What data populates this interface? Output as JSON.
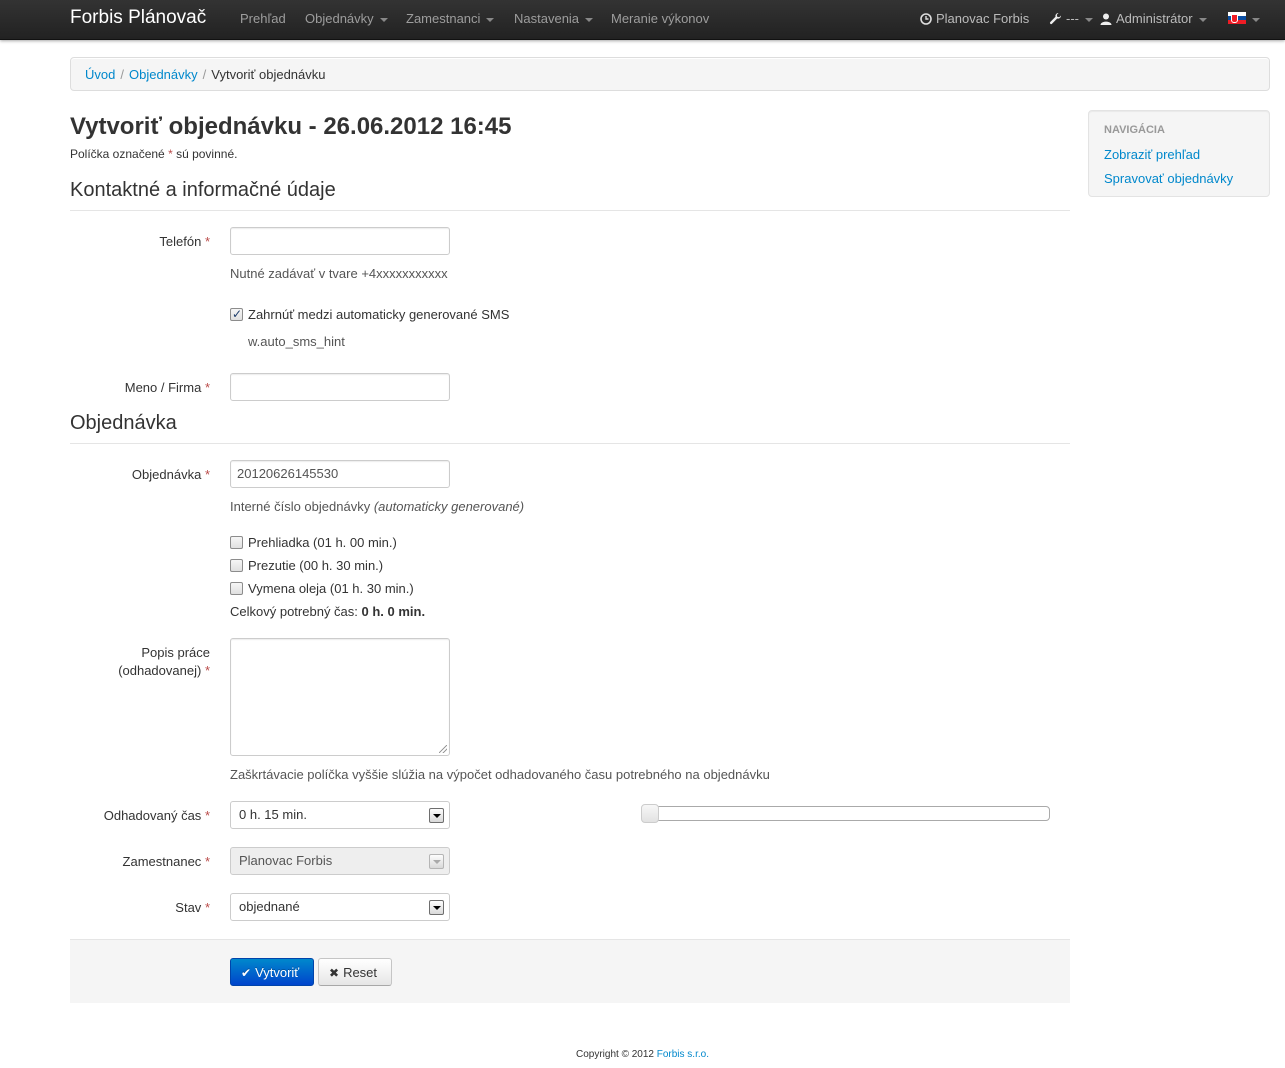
{
  "navbar": {
    "brand": "Forbis Plánovač",
    "items": [
      {
        "label": "Prehľad"
      },
      {
        "label": "Objednávky"
      },
      {
        "label": "Zamestnanci"
      },
      {
        "label": "Nastavenia"
      },
      {
        "label": "Meranie výkonov"
      }
    ],
    "right": {
      "planner_label": "Planovac Forbis",
      "tools_label": "---",
      "user_label": "Administrátor"
    }
  },
  "breadcrumb": {
    "items": [
      "Úvod",
      "Objednávky",
      "Vytvoriť objednávku"
    ],
    "separator": "/"
  },
  "page": {
    "title": "Vytvoriť objednávku - 26.06.2012 16:45",
    "required_note_before": "Políčka označené ",
    "required_note_after": " sú povinné.",
    "required_mark": "*"
  },
  "section_contact": {
    "legend": "Kontaktné a informačné údaje",
    "phone_label": "Telefón",
    "phone_value": "",
    "phone_help": "Nutné zadávať v tvare +4xxxxxxxxxxx",
    "sms_checkbox_label": "Zahrnúť medzi automaticky generované SMS",
    "sms_checked": true,
    "sms_hint": "w.auto_sms_hint",
    "name_label": "Meno / Firma",
    "name_value": ""
  },
  "section_order": {
    "legend": "Objednávka",
    "order_label": "Objednávka",
    "order_value": "20120626145530",
    "order_help_text": "Interné číslo objednávky ",
    "order_help_italic": "(automaticky generované)",
    "services": [
      {
        "label": "Prehliadka (01 h. 00 min.)",
        "checked": false
      },
      {
        "label": "Prezutie (00 h. 30 min.)",
        "checked": false
      },
      {
        "label": "Vymena oleja (01 h. 30 min.)",
        "checked": false
      }
    ],
    "total_time_label": "Celkový potrebný čas: ",
    "total_time_value": "0 h. 0 min.",
    "description_label_line1": "Popis práce",
    "description_label_line2": "(odhadovanej)",
    "description_value": "",
    "description_help": "Zaškrtávacie políčka vyššie slúžia na výpočet odhadovaného času potrebného na objednávku",
    "estimated_time_label": "Odhadovaný čas",
    "estimated_time_value": "0 h. 15 min.",
    "estimated_slider_level": 0,
    "employee_label": "Zamestnanec",
    "employee_value": "Planovac Forbis",
    "status_label": "Stav",
    "status_value": "objednané"
  },
  "actions": {
    "create_label": "Vytvoriť",
    "reset_label": "Reset"
  },
  "sidebar": {
    "header": "Navigácia",
    "links": [
      "Zobraziť prehľad",
      "Spravovať objednávky"
    ]
  },
  "footer": {
    "copyright": "Copyright © 2012 ",
    "company": "Forbis s.r.o."
  },
  "colors": {
    "accent": "#0088cc",
    "primary_button": "#0044cc",
    "navbar": "#222222",
    "required": "#b94a48"
  }
}
